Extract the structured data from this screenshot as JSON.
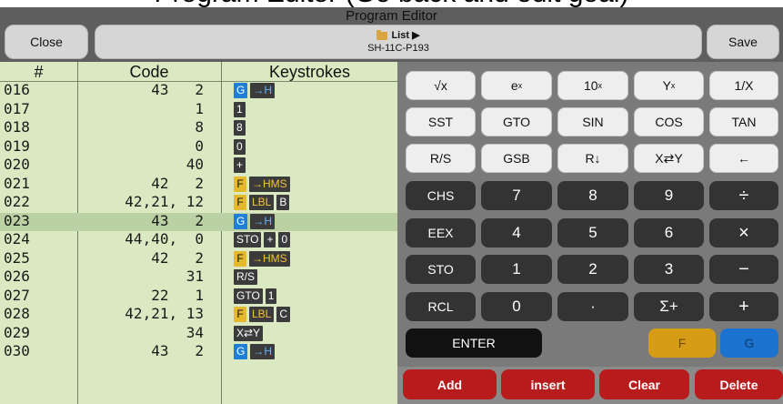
{
  "banner": {
    "text": "Program Editor (Go back and edit goal)"
  },
  "header": {
    "title": "Program Editor",
    "close_label": "Close",
    "save_label": "Save",
    "list_label": "List ▶",
    "program_name": "SH-11C-P193"
  },
  "listing": {
    "columns": [
      "#",
      "Code",
      "Keystrokes"
    ],
    "selected_index": 7,
    "rows": [
      {
        "num": "016",
        "code": "43   2",
        "keys": [
          {
            "t": "G",
            "c": "g"
          },
          {
            "t": "→H",
            "c": "dark-b"
          }
        ]
      },
      {
        "num": "017",
        "code": "1",
        "keys": [
          {
            "t": "1",
            "c": "dark"
          }
        ]
      },
      {
        "num": "018",
        "code": "8",
        "keys": [
          {
            "t": "8",
            "c": "dark"
          }
        ]
      },
      {
        "num": "019",
        "code": "0",
        "keys": [
          {
            "t": "0",
            "c": "dark"
          }
        ]
      },
      {
        "num": "020",
        "code": "40",
        "keys": [
          {
            "t": "+",
            "c": "dark"
          }
        ]
      },
      {
        "num": "021",
        "code": "42   2",
        "keys": [
          {
            "t": "F",
            "c": "f"
          },
          {
            "t": "→HMS",
            "c": "dark-y"
          }
        ]
      },
      {
        "num": "022",
        "code": "42,21, 12",
        "keys": [
          {
            "t": "F",
            "c": "f"
          },
          {
            "t": "LBL",
            "c": "dark-y"
          },
          {
            "t": "B",
            "c": "dark"
          }
        ]
      },
      {
        "num": "023",
        "code": "43   2",
        "keys": [
          {
            "t": "G",
            "c": "g"
          },
          {
            "t": "→H",
            "c": "dark-b"
          }
        ]
      },
      {
        "num": "024",
        "code": "44,40,  0",
        "keys": [
          {
            "t": "STO",
            "c": "dark"
          },
          {
            "t": "+",
            "c": "dark"
          },
          {
            "t": "0",
            "c": "dark"
          }
        ]
      },
      {
        "num": "025",
        "code": "42   2",
        "keys": [
          {
            "t": "F",
            "c": "f"
          },
          {
            "t": "→HMS",
            "c": "dark-y"
          }
        ]
      },
      {
        "num": "026",
        "code": "31",
        "keys": [
          {
            "t": "R/S",
            "c": "dark"
          }
        ]
      },
      {
        "num": "027",
        "code": "22   1",
        "keys": [
          {
            "t": "GTO",
            "c": "dark"
          },
          {
            "t": "1",
            "c": "dark"
          }
        ]
      },
      {
        "num": "028",
        "code": "42,21, 13",
        "keys": [
          {
            "t": "F",
            "c": "f"
          },
          {
            "t": "LBL",
            "c": "dark-y"
          },
          {
            "t": "C",
            "c": "dark"
          }
        ]
      },
      {
        "num": "029",
        "code": "34",
        "keys": [
          {
            "t": "X⇄Y",
            "c": "dark"
          }
        ]
      },
      {
        "num": "030",
        "code": "43   2",
        "keys": [
          {
            "t": "G",
            "c": "g"
          },
          {
            "t": "→H",
            "c": "dark-b"
          }
        ]
      }
    ]
  },
  "keypad": {
    "row1": [
      "√x",
      "e",
      "10",
      "Y",
      "1/X"
    ],
    "row1_sup": [
      "",
      "x",
      "x",
      "x",
      ""
    ],
    "row2": [
      "SST",
      "GTO",
      "SIN",
      "COS",
      "TAN"
    ],
    "row3": [
      "R/S",
      "GSB",
      "R↓",
      "X⇄Y",
      "←"
    ],
    "row4": [
      "CHS",
      "7",
      "8",
      "9",
      "÷"
    ],
    "row5": [
      "EEX",
      "4",
      "5",
      "6",
      "×"
    ],
    "row6": [
      "STO",
      "1",
      "2",
      "3",
      "−"
    ],
    "row7": [
      "RCL",
      "0",
      "·",
      "Σ+",
      "+"
    ],
    "enter_label": "ENTER",
    "f_label": "F",
    "g_label": "G"
  },
  "actions": {
    "add": "Add",
    "insert": "insert",
    "clear": "Clear",
    "delete": "Delete"
  },
  "colors": {
    "listing_bg": "#dae9c1",
    "selected_row": "#bcd1a3",
    "action_red": "#b81b1b",
    "f_key": "#d79c16",
    "g_key": "#1b73cf"
  }
}
